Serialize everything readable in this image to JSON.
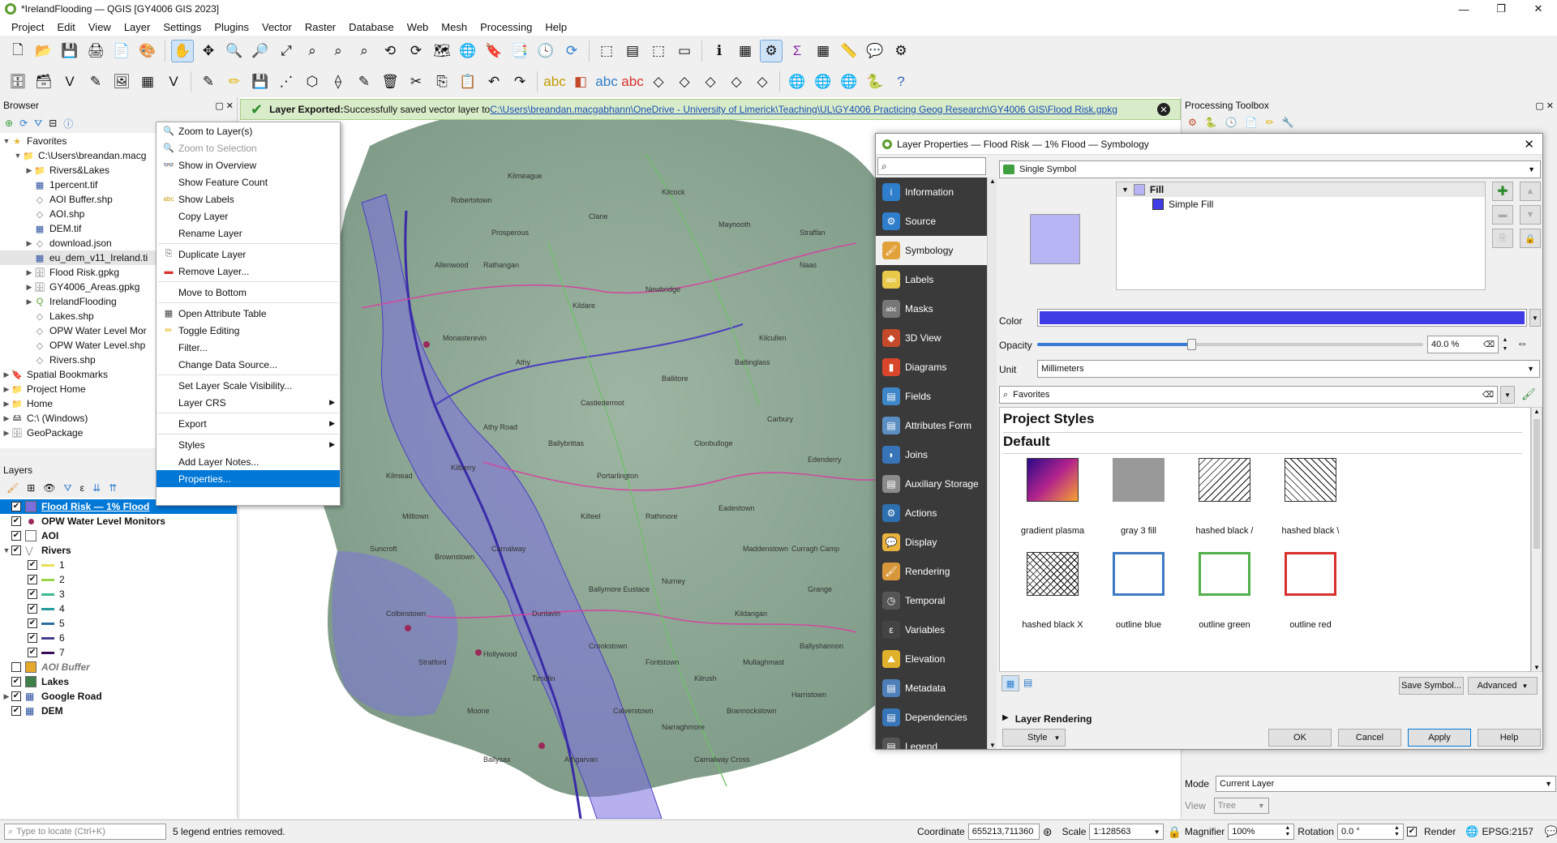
{
  "window": {
    "title": "*IrelandFlooding — QGIS [GY4006 GIS 2023]"
  },
  "menu": [
    "Project",
    "Edit",
    "View",
    "Layer",
    "Settings",
    "Plugins",
    "Vector",
    "Raster",
    "Database",
    "Web",
    "Mesh",
    "Processing",
    "Help"
  ],
  "browser": {
    "title": "Browser",
    "items": [
      {
        "label": "Favorites",
        "depth": 0,
        "expand": "v",
        "icon": "star-icon"
      },
      {
        "label": "C:\\Users\\breandan.macg",
        "depth": 1,
        "expand": "v",
        "icon": "folder-icon"
      },
      {
        "label": "Rivers&Lakes",
        "depth": 2,
        "expand": ">",
        "icon": "folder-icon"
      },
      {
        "label": "1percent.tif",
        "depth": 2,
        "expand": "",
        "icon": "raster-icon"
      },
      {
        "label": "AOI Buffer.shp",
        "depth": 2,
        "expand": "",
        "icon": "vector-icon"
      },
      {
        "label": "AOI.shp",
        "depth": 2,
        "expand": "",
        "icon": "vector-icon"
      },
      {
        "label": "DEM.tif",
        "depth": 2,
        "expand": "",
        "icon": "raster-icon"
      },
      {
        "label": "download.json",
        "depth": 2,
        "expand": ">",
        "icon": "vector-icon"
      },
      {
        "label": "eu_dem_v11_Ireland.ti",
        "depth": 2,
        "expand": "",
        "icon": "raster-icon"
      },
      {
        "label": "Flood Risk.gpkg",
        "depth": 2,
        "expand": ">",
        "icon": "db-icon"
      },
      {
        "label": "GY4006_Areas.gpkg",
        "depth": 2,
        "expand": ">",
        "icon": "db-icon"
      },
      {
        "label": "IrelandFlooding",
        "depth": 2,
        "expand": ">",
        "icon": "qgis-icon"
      },
      {
        "label": "Lakes.shp",
        "depth": 2,
        "expand": "",
        "icon": "vector-icon"
      },
      {
        "label": "OPW Water Level Mor",
        "depth": 2,
        "expand": "",
        "icon": "vector-icon"
      },
      {
        "label": "OPW Water Level.shp",
        "depth": 2,
        "expand": "",
        "icon": "vector-icon"
      },
      {
        "label": "Rivers.shp",
        "depth": 2,
        "expand": "",
        "icon": "vector-icon"
      },
      {
        "label": "Spatial Bookmarks",
        "depth": 0,
        "expand": ">",
        "icon": "bookmark-icon"
      },
      {
        "label": "Project Home",
        "depth": 0,
        "expand": ">",
        "icon": "folder-icon"
      },
      {
        "label": "Home",
        "depth": 0,
        "expand": ">",
        "icon": "folder-icon"
      },
      {
        "label": "C:\\ (Windows)",
        "depth": 0,
        "expand": ">",
        "icon": "drive-icon"
      },
      {
        "label": "GeoPackage",
        "depth": 0,
        "expand": ">",
        "icon": "db-icon"
      }
    ]
  },
  "layers": {
    "title": "Layers",
    "items": [
      {
        "label": "Flood Risk — 1% Flood",
        "depth": 0,
        "checked": true,
        "selected": true,
        "bold": true,
        "italic": false,
        "swatch": "#7b6fe0",
        "expand": ""
      },
      {
        "label": "OPW Water Level Monitors",
        "depth": 0,
        "checked": true,
        "selected": false,
        "bold": true,
        "italic": false,
        "swatch": "point",
        "expand": ""
      },
      {
        "label": "AOI",
        "depth": 0,
        "checked": true,
        "selected": false,
        "bold": true,
        "italic": false,
        "swatch": "#ffffff",
        "expand": ""
      },
      {
        "label": "Rivers",
        "depth": 0,
        "checked": true,
        "selected": false,
        "bold": true,
        "italic": false,
        "swatch": "line-grey",
        "expand": "v"
      },
      {
        "label": "1",
        "depth": 1,
        "checked": true,
        "selected": false,
        "bold": false,
        "italic": false,
        "swatch": "#e8e05a",
        "expand": ""
      },
      {
        "label": "2",
        "depth": 1,
        "checked": true,
        "selected": false,
        "bold": false,
        "italic": false,
        "swatch": "#9bd34a",
        "expand": ""
      },
      {
        "label": "3",
        "depth": 1,
        "checked": true,
        "selected": false,
        "bold": false,
        "italic": false,
        "swatch": "#3fb98c",
        "expand": ""
      },
      {
        "label": "4",
        "depth": 1,
        "checked": true,
        "selected": false,
        "bold": false,
        "italic": false,
        "swatch": "#269b9a",
        "expand": ""
      },
      {
        "label": "5",
        "depth": 1,
        "checked": true,
        "selected": false,
        "bold": false,
        "italic": false,
        "swatch": "#2e6c9f",
        "expand": ""
      },
      {
        "label": "6",
        "depth": 1,
        "checked": true,
        "selected": false,
        "bold": false,
        "italic": false,
        "swatch": "#443d8c",
        "expand": ""
      },
      {
        "label": "7",
        "depth": 1,
        "checked": true,
        "selected": false,
        "bold": false,
        "italic": false,
        "swatch": "#3a0f5a",
        "expand": ""
      },
      {
        "label": "AOI Buffer",
        "depth": 0,
        "checked": false,
        "selected": false,
        "bold": true,
        "italic": true,
        "swatch": "#e6a92a",
        "expand": ""
      },
      {
        "label": "Lakes",
        "depth": 0,
        "checked": true,
        "selected": false,
        "bold": true,
        "italic": false,
        "swatch": "#3f7f4a",
        "expand": ""
      },
      {
        "label": "Google Road",
        "depth": 0,
        "checked": true,
        "selected": false,
        "bold": true,
        "italic": false,
        "swatch": "raster",
        "expand": ">"
      },
      {
        "label": "DEM",
        "depth": 0,
        "checked": true,
        "selected": false,
        "bold": true,
        "italic": false,
        "swatch": "raster",
        "expand": ""
      }
    ]
  },
  "message": {
    "title": "Layer Exported:",
    "text": " Successfully saved vector layer to ",
    "link": "C:\\Users\\breandan.macgabhann\\OneDrive - University of Limerick\\Teaching\\UL\\GY4006 Practicing Geog Research\\GY4006 GIS\\Flood Risk.gpkg"
  },
  "context_menu": [
    {
      "label": "Zoom to Layer(s)",
      "icon": "zoom-layer-icon",
      "state": "normal",
      "submenu": false
    },
    {
      "label": "Zoom to Selection",
      "icon": "zoom-selection-icon",
      "state": "disabled",
      "submenu": false
    },
    {
      "label": "Show in Overview",
      "icon": "overview-icon",
      "state": "normal",
      "submenu": false
    },
    {
      "label": "Show Feature Count",
      "icon": "",
      "state": "normal",
      "submenu": false
    },
    {
      "label": "Show Labels",
      "icon": "labels-icon",
      "state": "normal",
      "submenu": false
    },
    {
      "label": "Copy Layer",
      "icon": "",
      "state": "normal",
      "submenu": false
    },
    {
      "label": "Rename Layer",
      "icon": "",
      "state": "normal",
      "submenu": false
    },
    {
      "sep": true
    },
    {
      "label": "Duplicate Layer",
      "icon": "duplicate-icon",
      "state": "normal",
      "submenu": false
    },
    {
      "label": "Remove Layer...",
      "icon": "remove-icon",
      "state": "normal",
      "submenu": false
    },
    {
      "sep": true
    },
    {
      "label": "Move to Bottom",
      "icon": "",
      "state": "normal",
      "submenu": false
    },
    {
      "sep": true
    },
    {
      "label": "Open Attribute Table",
      "icon": "table-icon",
      "state": "normal",
      "submenu": false
    },
    {
      "label": "Toggle Editing",
      "icon": "pencil-icon",
      "state": "normal",
      "submenu": false
    },
    {
      "label": "Filter...",
      "icon": "",
      "state": "normal",
      "submenu": false
    },
    {
      "label": "Change Data Source...",
      "icon": "",
      "state": "normal",
      "submenu": false
    },
    {
      "sep": true
    },
    {
      "label": "Set Layer Scale Visibility...",
      "icon": "",
      "state": "normal",
      "submenu": false
    },
    {
      "label": "Layer CRS",
      "icon": "",
      "state": "normal",
      "submenu": true
    },
    {
      "sep": true
    },
    {
      "label": "Export",
      "icon": "",
      "state": "normal",
      "submenu": true
    },
    {
      "sep": true
    },
    {
      "label": "Styles",
      "icon": "",
      "state": "normal",
      "submenu": true
    },
    {
      "label": "Add Layer Notes...",
      "icon": "",
      "state": "normal",
      "submenu": false
    },
    {
      "label": "Properties...",
      "icon": "",
      "state": "highlighted",
      "submenu": false
    }
  ],
  "map_labels": [
    "Kilmeague",
    "Robertstown",
    "Prosperous",
    "Allenwood",
    "Clane",
    "Kilcock",
    "Maynooth",
    "Straffan",
    "Naas",
    "Kilcullen",
    "Newbridge",
    "Kildare",
    "Rathangan",
    "Monasterevin",
    "Athy",
    "Castledermot",
    "Ballitore",
    "Baltinglass",
    "Carbury",
    "Edenderry",
    "Clonbulloge",
    "Portarlington",
    "Ballybrittas",
    "Athy Road",
    "Kilberry",
    "Kilmead",
    "Milltown",
    "Suncroft",
    "Brownstown",
    "Carnalway",
    "Kilteel",
    "Rathmore",
    "Eadestown",
    "Maddenstown",
    "Curragh Camp",
    "Grange",
    "Kildangan",
    "Nurney",
    "Ballymore Eustace",
    "Dunlavin",
    "Hollywood",
    "Stratford",
    "Colbinstown",
    "Moone",
    "Timolin",
    "Crookstown",
    "Fontstown",
    "Kilrush",
    "Mullaghmast",
    "Ballyshannon",
    "Narraghmore",
    "Calverstown",
    "Athgarvan",
    "Ballysax",
    "Brannockstown",
    "Harristown",
    "Carnalway Cross"
  ],
  "processing": {
    "title": "Processing Toolbox",
    "mode_label": "Mode",
    "mode_value": "Current Layer",
    "view_label": "View",
    "view_value": "Tree"
  },
  "dialog": {
    "title": "Layer Properties — Flood Risk — 1% Flood — Symbology",
    "search_placeholder": "",
    "sidebar": [
      {
        "label": "Information",
        "icon": "info-icon",
        "color": "#2f7ecb",
        "selected": false
      },
      {
        "label": "Source",
        "icon": "source-icon",
        "color": "#2f7ecb",
        "selected": false
      },
      {
        "label": "Symbology",
        "icon": "symbology-icon",
        "color": "#e2a23b",
        "selected": true
      },
      {
        "label": "Labels",
        "icon": "labels-icon",
        "color": "#e8c94a",
        "selected": false
      },
      {
        "label": "Masks",
        "icon": "masks-icon",
        "color": "#777777",
        "selected": false
      },
      {
        "label": "3D View",
        "icon": "3d-view-icon",
        "color": "#c44a2a",
        "selected": false
      },
      {
        "label": "Diagrams",
        "icon": "diagrams-icon",
        "color": "#d9462b",
        "selected": false
      },
      {
        "label": "Fields",
        "icon": "fields-icon",
        "color": "#3f86c9",
        "selected": false
      },
      {
        "label": "Attributes Form",
        "icon": "form-icon",
        "color": "#5b8fc4",
        "selected": false
      },
      {
        "label": "Joins",
        "icon": "joins-icon",
        "color": "#3874b8",
        "selected": false
      },
      {
        "label": "Auxiliary Storage",
        "icon": "storage-icon",
        "color": "#8b8b8b",
        "selected": false
      },
      {
        "label": "Actions",
        "icon": "actions-icon",
        "color": "#2e6fb0",
        "selected": false
      },
      {
        "label": "Display",
        "icon": "display-icon",
        "color": "#e8b23c",
        "selected": false
      },
      {
        "label": "Rendering",
        "icon": "rendering-icon",
        "color": "#d7973a",
        "selected": false
      },
      {
        "label": "Temporal",
        "icon": "temporal-icon",
        "color": "#555555",
        "selected": false
      },
      {
        "label": "Variables",
        "icon": "variables-icon",
        "color": "#444444",
        "selected": false
      },
      {
        "label": "Elevation",
        "icon": "elevation-icon",
        "color": "#e2b12c",
        "selected": false
      },
      {
        "label": "Metadata",
        "icon": "metadata-icon",
        "color": "#4f7fb9",
        "selected": false
      },
      {
        "label": "Dependencies",
        "icon": "dependencies-icon",
        "color": "#3874b8",
        "selected": false
      },
      {
        "label": "Legend",
        "icon": "legend-icon",
        "color": "#555555",
        "selected": false
      }
    ],
    "renderer": "Single Symbol",
    "symbol_tree": {
      "fill": "Fill",
      "simple_fill": "Simple Fill"
    },
    "color_label": "Color",
    "color_value": "#3f3ce6",
    "opacity_label": "Opacity",
    "opacity_value": "40.0 %",
    "opacity_fraction": 0.4,
    "unit_label": "Unit",
    "unit_value": "Millimeters",
    "library_filter": "Favorites",
    "project_styles": "Project Styles",
    "default": "Default",
    "symbols": [
      {
        "label": "gradient  plasma",
        "type": "gradient"
      },
      {
        "label": "gray 3 fill",
        "type": "gray"
      },
      {
        "label": "hashed black /",
        "type": "hash-fwd"
      },
      {
        "label": "hashed black \\",
        "type": "hash-back"
      },
      {
        "label": "hashed black X",
        "type": "hash-x"
      },
      {
        "label": "outline blue",
        "type": "outline",
        "color": "#3d78c4"
      },
      {
        "label": "outline green",
        "type": "outline",
        "color": "#52b04a"
      },
      {
        "label": "outline red",
        "type": "outline",
        "color": "#d8302c"
      }
    ],
    "save_symbol": "Save Symbol...",
    "advanced": "Advanced",
    "layer_rendering": "Layer Rendering",
    "style_btn": "Style",
    "ok": "OK",
    "cancel": "Cancel",
    "apply": "Apply",
    "help": "Help"
  },
  "status": {
    "locate_placeholder": "Type to locate (Ctrl+K)",
    "message": "5 legend entries removed.",
    "coordinate_label": "Coordinate",
    "coordinate_value": "655213,711360",
    "scale_label": "Scale",
    "scale_value": "1:128563",
    "magnifier_label": "Magnifier",
    "magnifier_value": "100%",
    "rotation_label": "Rotation",
    "rotation_value": "0.0 °",
    "render_label": "Render",
    "crs": "EPSG:2157"
  }
}
